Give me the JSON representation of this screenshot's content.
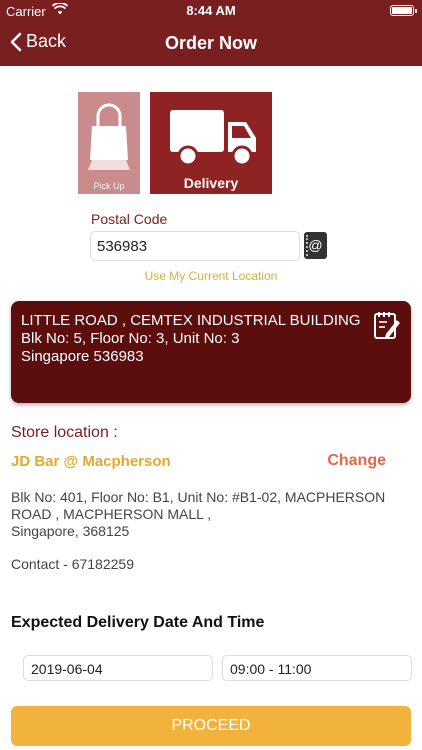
{
  "status_bar": {
    "carrier": "Carrier",
    "time": "8:44 AM"
  },
  "nav": {
    "back_label": "Back",
    "title": "Order Now"
  },
  "modes": {
    "pickup_label": "Pick Up",
    "delivery_label": "Delivery",
    "selected": "Delivery"
  },
  "postal": {
    "label": "Postal Code",
    "value": "536983",
    "use_location": "Use My Current Location"
  },
  "address": {
    "line1": "LITTLE ROAD , CEMTEX INDUSTRIAL BUILDING",
    "line2": "Blk No: 5, Floor No: 3, Unit No: 3",
    "line3": "Singapore 536983"
  },
  "store": {
    "heading": "Store location :",
    "name": "JD Bar @ Macpherson",
    "change_label": "Change",
    "address_line1": "Blk No: 401, Floor No: B1, Unit No: #B1-02, MACPHERSON ROAD , MACPHERSON MALL ,",
    "address_line2": "Singapore, 368125",
    "contact": "Contact - 67182259"
  },
  "delivery": {
    "heading": "Expected Delivery Date And Time",
    "date": "2019-06-04",
    "time": "09:00 - 11:00"
  },
  "proceed_label": "PROCEED",
  "colors": {
    "brand": "#7a1f1f",
    "card": "#5c0d0d",
    "accent": "#f2b33d",
    "store_name": "#e3a92c",
    "change": "#e06a4a"
  }
}
